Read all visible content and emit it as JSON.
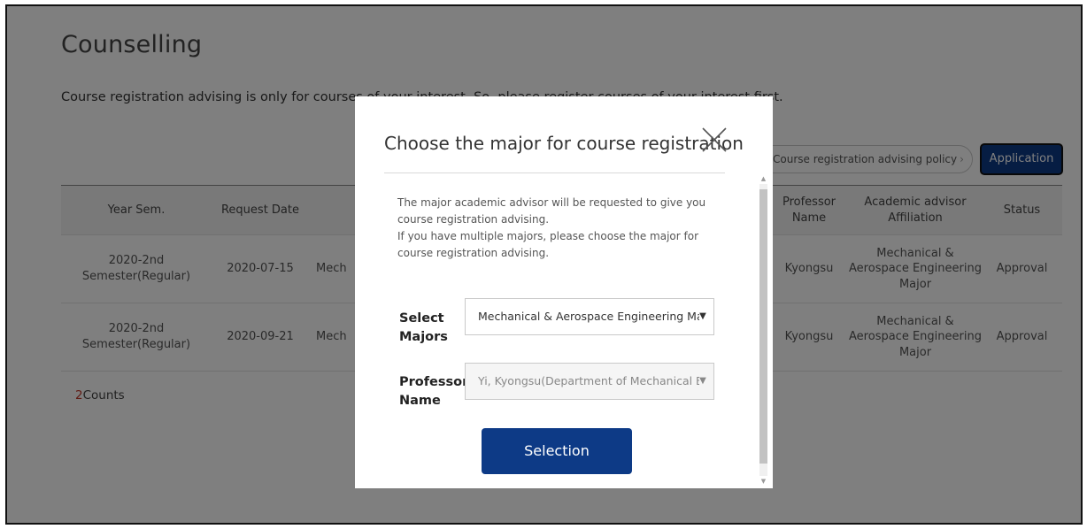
{
  "page": {
    "title": "Counselling",
    "notice": "Course registration advising is only for courses of your interest. So, please register courses of your interest first."
  },
  "toolbar": {
    "policy_link": "Course registration advising policy",
    "application_button": "Application"
  },
  "table": {
    "headers": [
      "Year Sem.",
      "Request Date",
      "",
      "Professor Name",
      "Academic advisor Affiliation",
      "Status"
    ],
    "rows": [
      {
        "year_sem": "2020-2nd Semester(Regular)",
        "request_date": "2020-07-15",
        "major": "Mech",
        "professor": "Kyongsu",
        "affiliation": "Mechanical & Aerospace Engineering Major",
        "status": "Approval"
      },
      {
        "year_sem": "2020-2nd Semester(Regular)",
        "request_date": "2020-09-21",
        "major": "Mech",
        "professor": "Kyongsu",
        "affiliation": "Mechanical & Aerospace Engineering Major",
        "status": "Approval"
      }
    ],
    "count_number": "2",
    "count_label": "Counts"
  },
  "modal": {
    "title": "Choose the major for course registration",
    "description_line1": "The major academic advisor will be requested to give you course registration advising.",
    "description_line2": "If you have multiple majors, please choose the major for course registration advising.",
    "majors_label": "Select Majors",
    "majors_value": "Mechanical & Aerospace Engineering Major",
    "professor_label": "Professor Name",
    "professor_value": "Yi, Kyongsu(Department of Mechanical E",
    "selection_button": "Selection"
  },
  "icons": {
    "close": "close-icon",
    "chevron": "chevron-right-icon",
    "caret": "chevron-down-icon"
  },
  "colors": {
    "primary": "#0d3a86",
    "count_accent": "#c0392b"
  }
}
